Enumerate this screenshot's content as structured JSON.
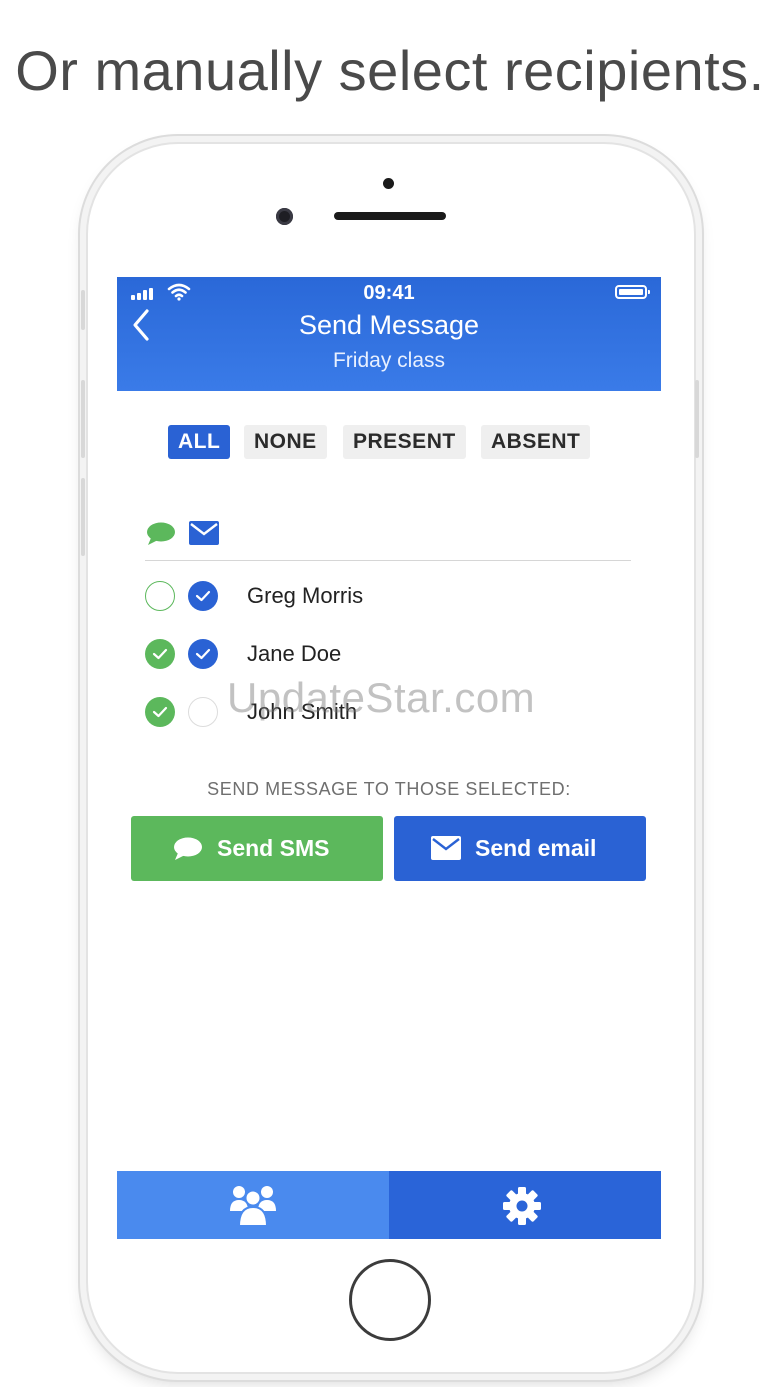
{
  "headline": "Or manually select recipients.",
  "status_bar": {
    "time": "09:41"
  },
  "navbar": {
    "title": "Send Message",
    "subtitle": "Friday class",
    "back_icon": "chevron-left-icon"
  },
  "filters": [
    {
      "label": "ALL",
      "active": true
    },
    {
      "label": "NONE",
      "active": false
    },
    {
      "label": "PRESENT",
      "active": false
    },
    {
      "label": "ABSENT",
      "active": false
    }
  ],
  "column_icons": {
    "sms": "chat-bubble-icon",
    "email": "envelope-icon"
  },
  "recipients": [
    {
      "name": "Greg Morris",
      "sms_selected": false,
      "email_selected": true
    },
    {
      "name": "Jane Doe",
      "sms_selected": true,
      "email_selected": true
    },
    {
      "name": "John Smith",
      "sms_selected": true,
      "email_selected": false
    }
  ],
  "watermark": "UpdateStar.com",
  "send_prompt": "SEND MESSAGE TO THOSE SELECTED:",
  "buttons": {
    "sms": "Send SMS",
    "email": "Send email"
  },
  "tabbar": {
    "people_icon": "people-icon",
    "settings_icon": "gear-icon",
    "active_tab": "people"
  },
  "colors": {
    "primary_blue": "#2a62d4",
    "green": "#5cb85c",
    "tab_active": "#4a8aee"
  }
}
